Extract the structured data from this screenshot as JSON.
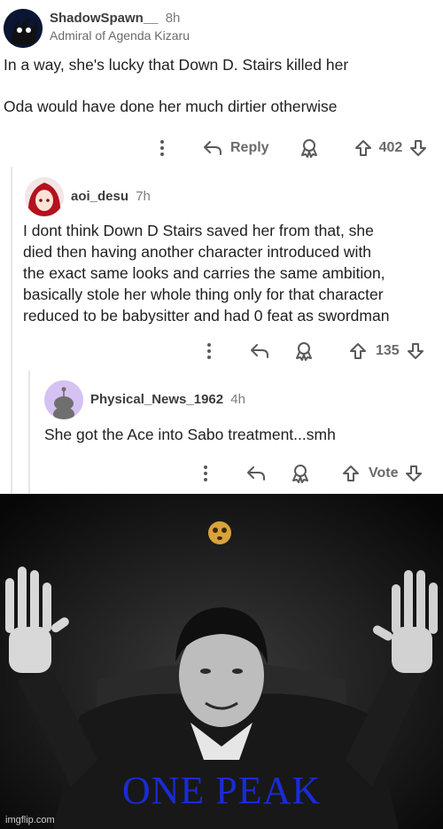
{
  "comments": [
    {
      "username": "ShadowSpawn__",
      "time": "8h",
      "flair": "Admiral of Agenda Kizaru",
      "body": [
        "In a way, she's lucky that Down D. Stairs killed her",
        "",
        "Oda would have done her much dirtier otherwise"
      ],
      "reply_label": "Reply",
      "votes": "402"
    },
    {
      "username": "aoi_desu",
      "time": "7h",
      "body": [
        "I dont think Down D Stairs saved her from that, she",
        "died then having another character introduced with",
        "the exact same looks and carries the same ambition,",
        "basically stole her whole thing only for that character",
        "reduced to be babysitter and had 0 feat as swordman"
      ],
      "votes": "135"
    },
    {
      "username": "Physical_News_1962",
      "time": "4h",
      "body": [
        "She got the Ace into Sabo treatment...smh"
      ],
      "votes": "Vote"
    }
  ],
  "meme": {
    "caption": "ONE PEAK",
    "watermark": "imgflip.com"
  },
  "colors": {
    "caption": "#1a2bd8",
    "thread_line": "#e6e6e6"
  }
}
